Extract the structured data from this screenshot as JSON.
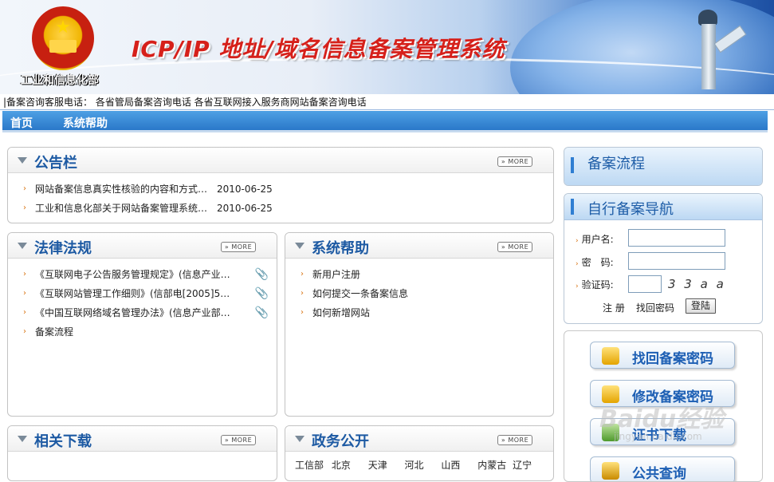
{
  "header": {
    "ministry": "工业和信息化部",
    "system_title": "ICP/IP 地址/域名信息备案管理系统"
  },
  "hotline": "|备案咨询客服电话：  各省管局备案咨询电话  各省互联网接入服务商网站备案咨询电话",
  "nav": {
    "home": "首页",
    "help": "系统帮助"
  },
  "more_label": "» MORE",
  "bulletin": {
    "title": "公告栏",
    "items": [
      {
        "text": "网站备案信息真实性核验的内容和方式…",
        "date": "2010-06-25"
      },
      {
        "text": "工业和信息化部关于网站备案管理系统…",
        "date": "2010-06-25"
      }
    ]
  },
  "laws": {
    "title": "法律法规",
    "items": [
      "《互联网电子公告服务管理规定》(信息产业…",
      "《互联网站管理工作细则》(信部电[2005]5…",
      "《中国互联网络域名管理办法》(信息产业部…",
      "备案流程"
    ]
  },
  "help": {
    "title": "系统帮助",
    "items": [
      "新用户注册",
      "如何提交一条备案信息",
      "如何新增网站"
    ]
  },
  "downloads": {
    "title": "相关下载"
  },
  "gov": {
    "title": "政务公开",
    "items": [
      "工信部",
      "北京",
      "天津",
      "河北",
      "山西",
      "内蒙古",
      "辽宁"
    ]
  },
  "process": {
    "title": "备案流程"
  },
  "login": {
    "title": "自行备案导航",
    "username_label": "用户名:",
    "password_label": "密　码:",
    "captcha_label": "验证码:",
    "captcha_text": "3 3 a a",
    "register": "注 册",
    "recover": "找回密码",
    "submit": "登陆"
  },
  "quick": {
    "recover_pwd": "找回备案密码",
    "change_pwd": "修改备案密码",
    "cert_download": "证书下载",
    "public_query": "公共查询"
  },
  "watermark": {
    "brand": "Baidu经验",
    "url": "jingyan.baidu.com"
  }
}
